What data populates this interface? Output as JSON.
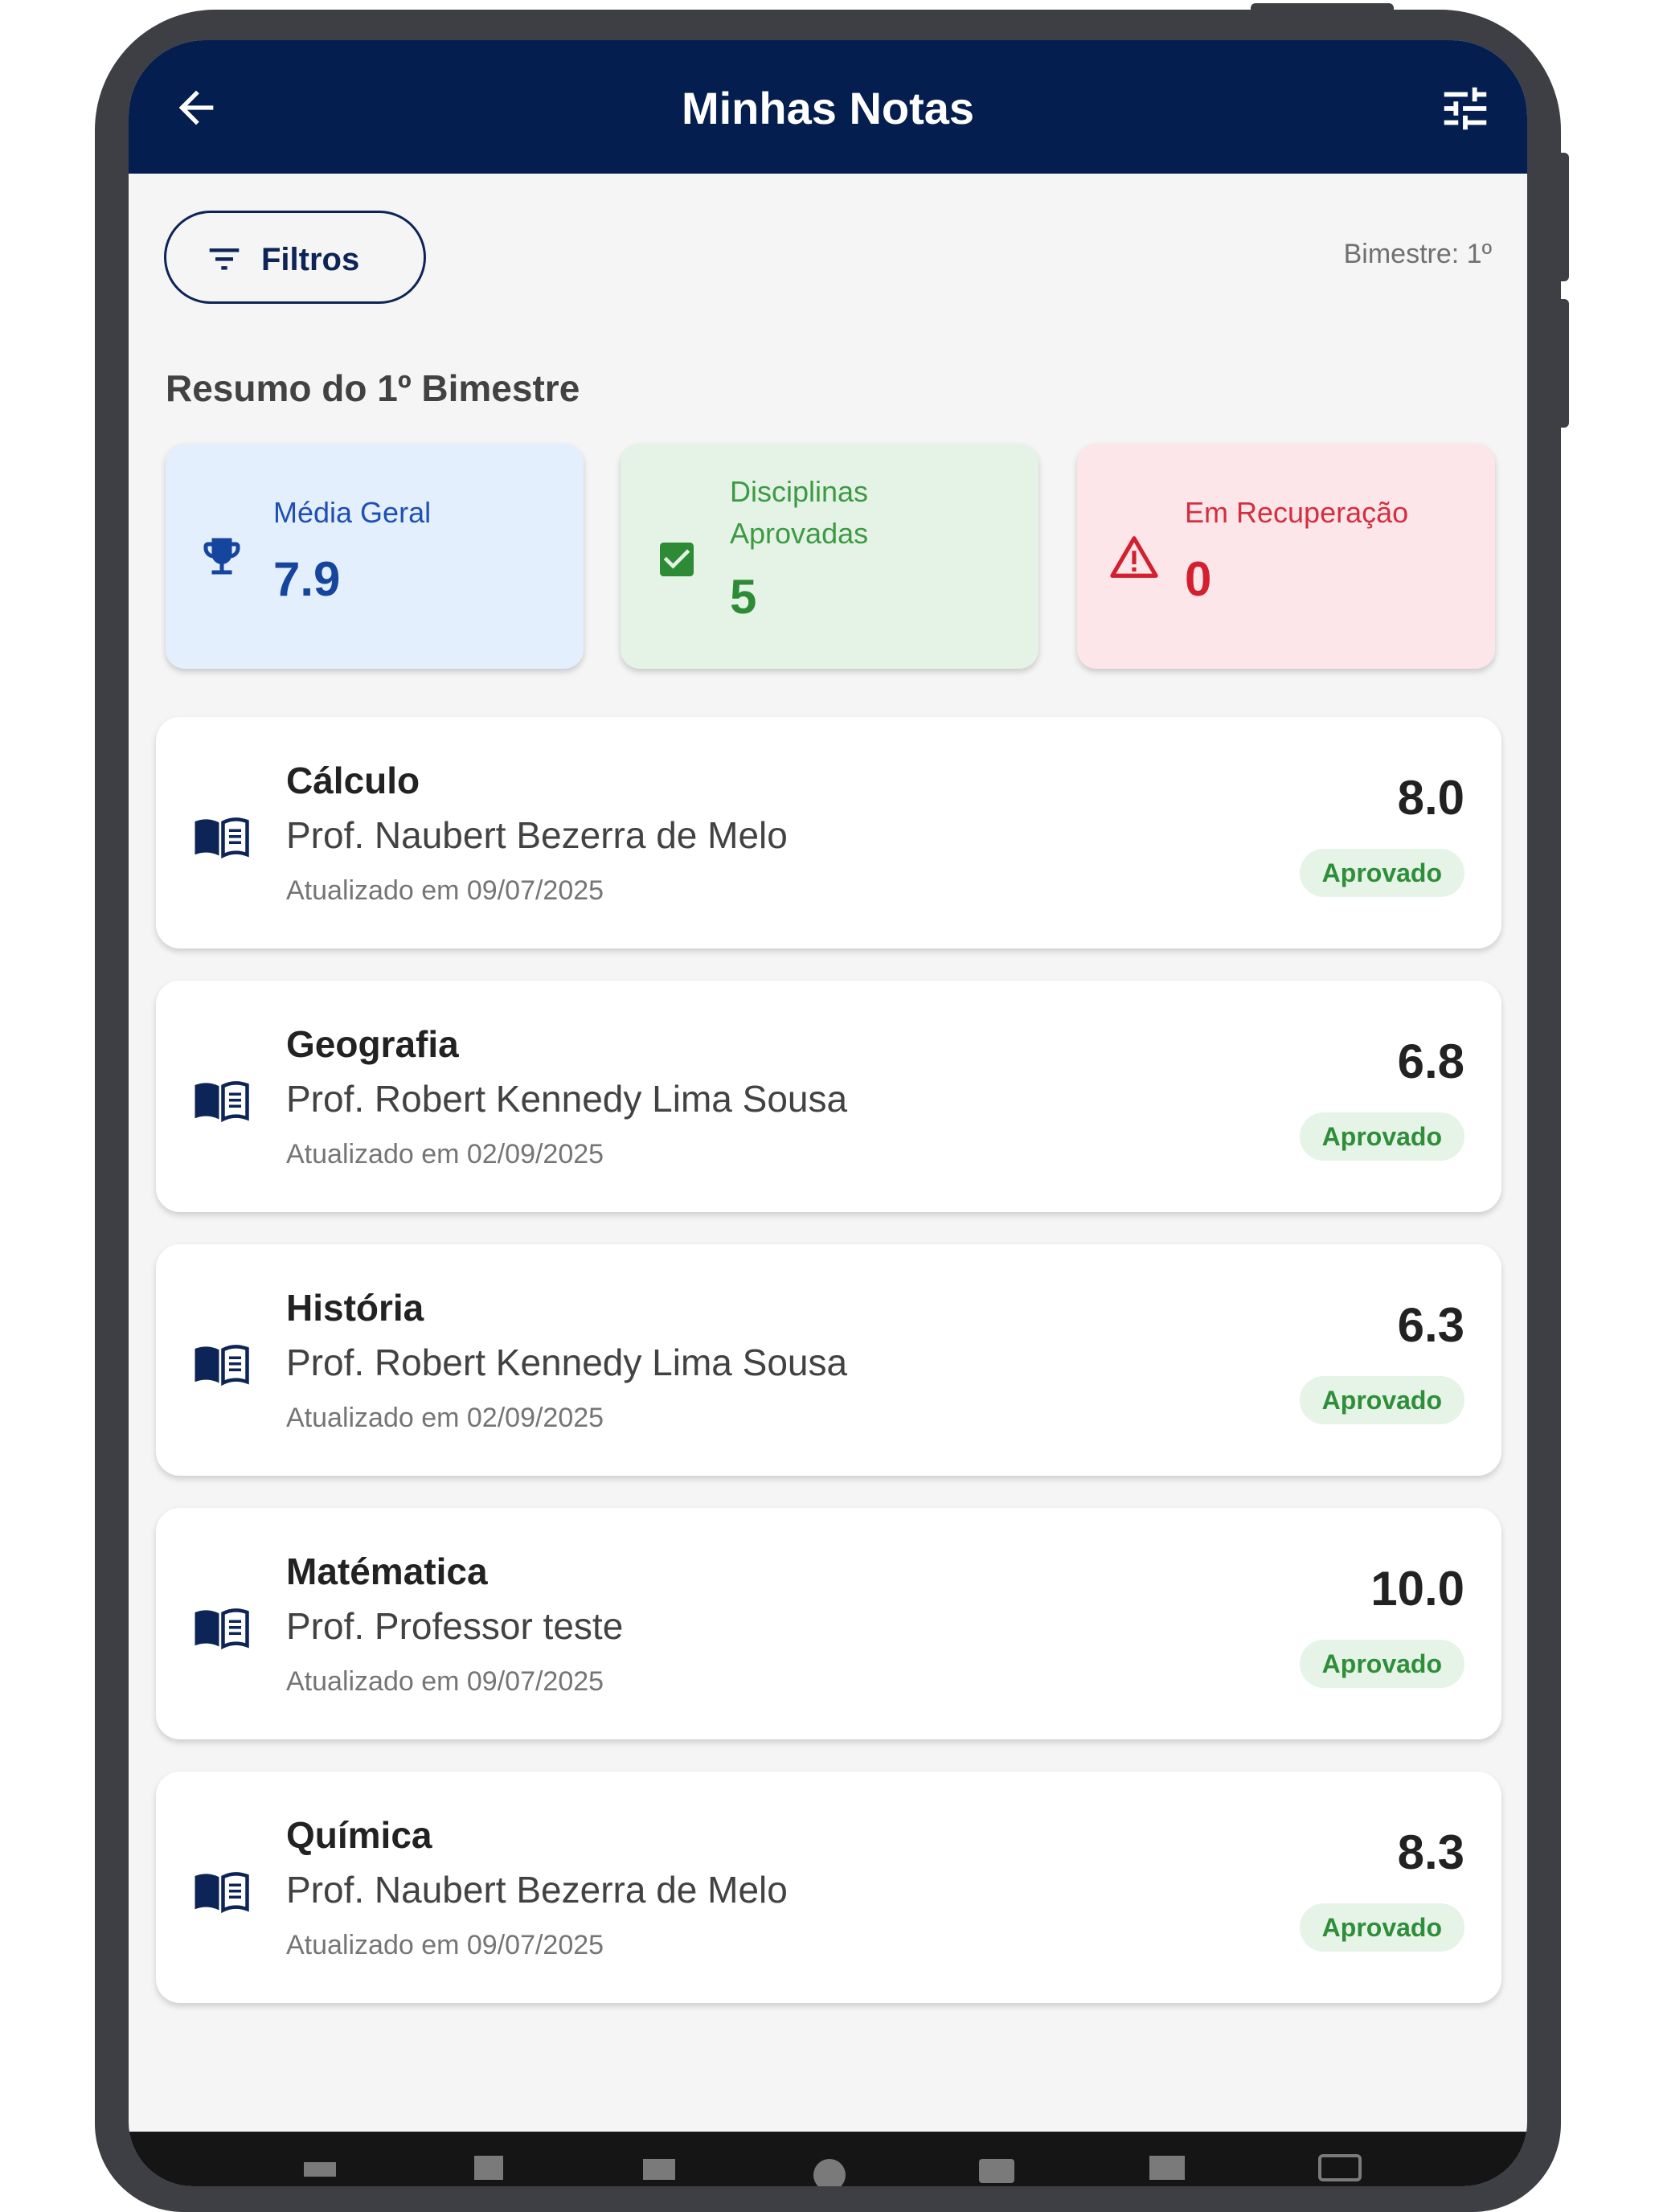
{
  "appbar": {
    "title": "Minhas Notas",
    "back_icon": "arrow-back-icon",
    "tune_icon": "tune-icon"
  },
  "filters": {
    "button_label": "Filtros",
    "icon": "filter-list-icon",
    "bimestre_label": "Bimestre: 1º"
  },
  "summary": {
    "title": "Resumo do 1º Bimestre",
    "cards": [
      {
        "label": "Média Geral",
        "value": "7.9",
        "icon": "trophy-icon",
        "color": "#1f4fb3",
        "bg": "#e3effd"
      },
      {
        "label": "Disciplinas Aprovadas",
        "value": "5",
        "icon": "checkbox-icon",
        "color": "#3d9a43",
        "bg": "#e5f3e6"
      },
      {
        "label": "Em Recuperação",
        "value": "0",
        "icon": "warning-icon",
        "color": "#d32f3f",
        "bg": "#fde6ea"
      }
    ]
  },
  "subjects": [
    {
      "name": "Cálculo",
      "professor": "Prof. Naubert Bezerra de Melo",
      "updated": "Atualizado em 09/07/2025",
      "grade": "8.0",
      "status": "Aprovado"
    },
    {
      "name": "Geografia",
      "professor": "Prof. Robert Kennedy Lima Sousa",
      "updated": "Atualizado em 02/09/2025",
      "grade": "6.8",
      "status": "Aprovado"
    },
    {
      "name": "História",
      "professor": "Prof. Robert Kennedy Lima Sousa",
      "updated": "Atualizado em 02/09/2025",
      "grade": "6.3",
      "status": "Aprovado"
    },
    {
      "name": "Matématica",
      "professor": "Prof. Professor teste",
      "updated": "Atualizado em 09/07/2025",
      "grade": "10.0",
      "status": "Aprovado"
    },
    {
      "name": "Química",
      "professor": "Prof. Naubert Bezerra de Melo",
      "updated": "Atualizado em 09/07/2025",
      "grade": "8.3",
      "status": "Aprovado"
    }
  ],
  "colors": {
    "appbar": "#041e4f",
    "status_approved": "#2f8e3a",
    "status_approved_bg": "#e6f3e7",
    "book_icon": "#0d2456"
  }
}
